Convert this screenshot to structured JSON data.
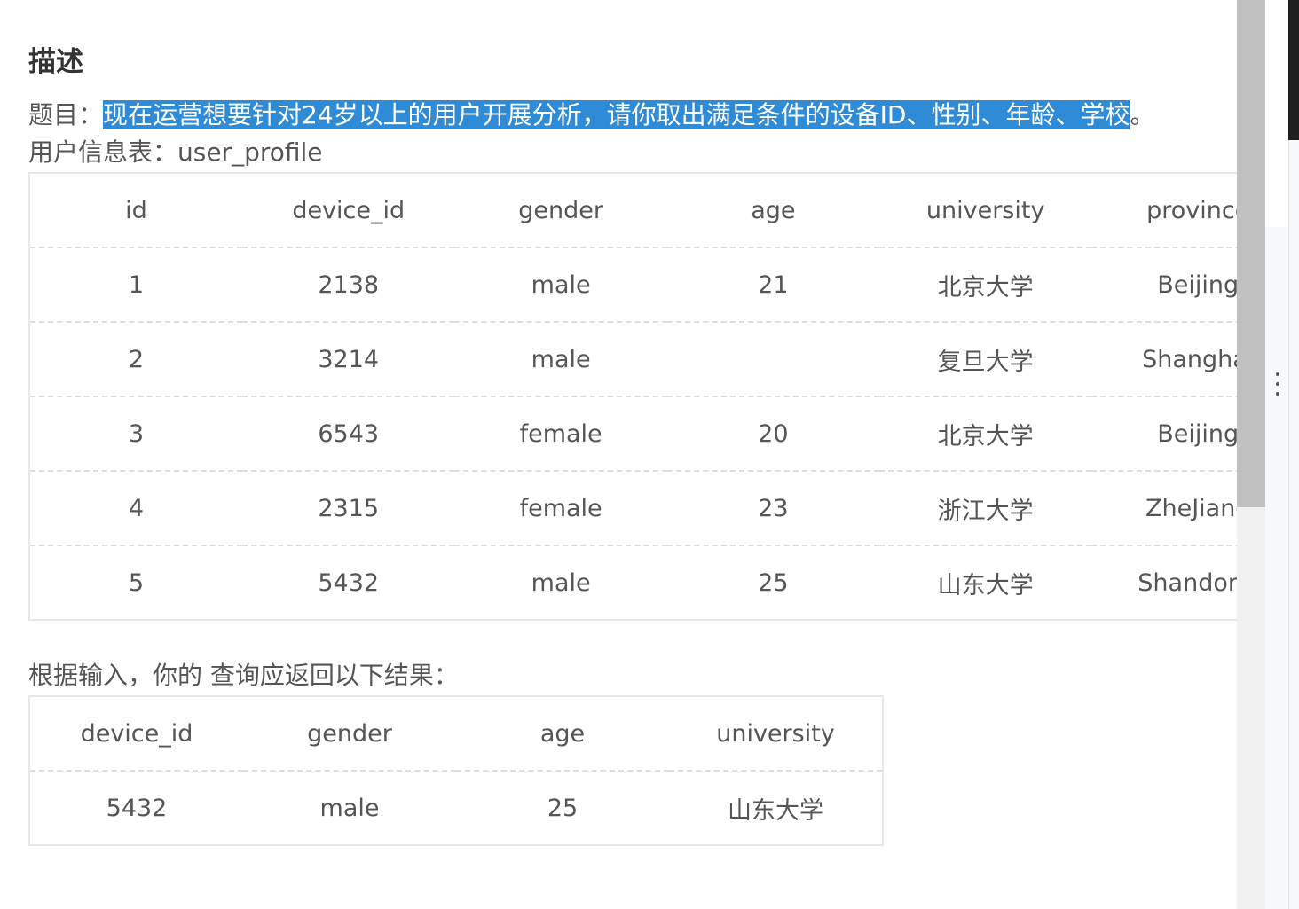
{
  "description": {
    "heading": "描述",
    "question_prefix": "题目：",
    "question_highlight": "现在运营想要针对24岁以上的用户开展分析，请你取出满足条件的设备ID、性别、年龄、学校",
    "question_suffix": "。",
    "table_intro": "用户信息表：user_profile",
    "result_intro": "根据输入，你的 查询应返回以下结果："
  },
  "user_profile_table": {
    "headers": [
      "id",
      "device_id",
      "gender",
      "age",
      "university",
      "province"
    ],
    "rows": [
      [
        "1",
        "2138",
        "male",
        "21",
        "北京大学",
        "Beijing"
      ],
      [
        "2",
        "3214",
        "male",
        "",
        "复旦大学",
        "Shanghai"
      ],
      [
        "3",
        "6543",
        "female",
        "20",
        "北京大学",
        "Beijing"
      ],
      [
        "4",
        "2315",
        "female",
        "23",
        "浙江大学",
        "ZheJiang"
      ],
      [
        "5",
        "5432",
        "male",
        "25",
        "山东大学",
        "Shandong"
      ]
    ]
  },
  "result_table": {
    "headers": [
      "device_id",
      "gender",
      "age",
      "university"
    ],
    "rows": [
      [
        "5432",
        "male",
        "25",
        "山东大学"
      ]
    ]
  },
  "colors": {
    "highlight": "#2f8bd6",
    "text": "#555555",
    "heading": "#333333",
    "scrollbar_thumb": "#c1c1c1"
  },
  "icons": {
    "side_menu": "more-vertical-icon"
  }
}
